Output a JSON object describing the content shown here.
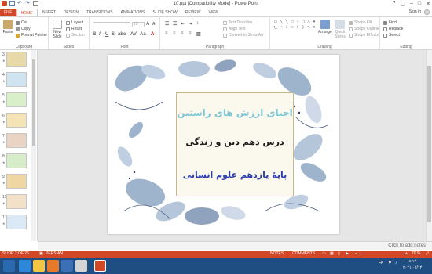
{
  "window": {
    "title": "10.ppt [Compatibility Mode] - PowerPoint",
    "controls": [
      "?",
      "▢",
      "–",
      "□",
      "✕"
    ]
  },
  "tabs": [
    "FILE",
    "HOME",
    "INSERT",
    "DESIGN",
    "TRANSITIONS",
    "ANIMATIONS",
    "SLIDE SHOW",
    "REVIEW",
    "VIEW"
  ],
  "account": {
    "sign_in": "Sign in"
  },
  "ribbon": {
    "clipboard": {
      "label": "Clipboard",
      "paste": "Paste",
      "cut": "Cut",
      "copy": "Copy",
      "format_painter": "Format Painter"
    },
    "slides": {
      "label": "Slides",
      "new_slide": "New Slide",
      "layout": "Layout",
      "reset": "Reset",
      "section": "Section"
    },
    "font": {
      "label": "Font",
      "size": "25"
    },
    "paragraph": {
      "label": "Paragraph",
      "text_direction": "Text Direction",
      "align_text": "Align Text",
      "convert_smartart": "Convert to SmartArt"
    },
    "drawing": {
      "label": "Drawing",
      "arrange": "Arrange",
      "quick_styles": "Quick Styles",
      "shape_fill": "Shape Fill",
      "shape_outline": "Shape Outline",
      "shape_effects": "Shape Effects"
    },
    "editing": {
      "label": "Editing",
      "find": "Find",
      "replace": "Replace",
      "select": "Select"
    }
  },
  "thumbnails": [
    {
      "num": "3"
    },
    {
      "num": "4"
    },
    {
      "num": "5"
    },
    {
      "num": "6"
    },
    {
      "num": "7"
    },
    {
      "num": "8"
    },
    {
      "num": "9"
    },
    {
      "num": "10"
    },
    {
      "num": "11"
    }
  ],
  "slide": {
    "line1": "احیای ارزش های راستین",
    "line2": "درس دهم دین و زندگی",
    "line3": "پایۀ یازدهم علوم انسانی"
  },
  "notes": {
    "placeholder": "Click to add notes"
  },
  "status": {
    "slide_info": "SLIDE 2 OF 25",
    "language": "PERSIAN",
    "notes": "NOTES",
    "comments": "COMMENTS",
    "zoom": "70 %"
  },
  "taskbar": {
    "lang": "FA",
    "time": "۰۸:۱۹",
    "date": "۲۰۲۱/۰۴/۱۴"
  },
  "colors": {
    "accent": "#d24726",
    "taskbar": "#1f4f82"
  }
}
